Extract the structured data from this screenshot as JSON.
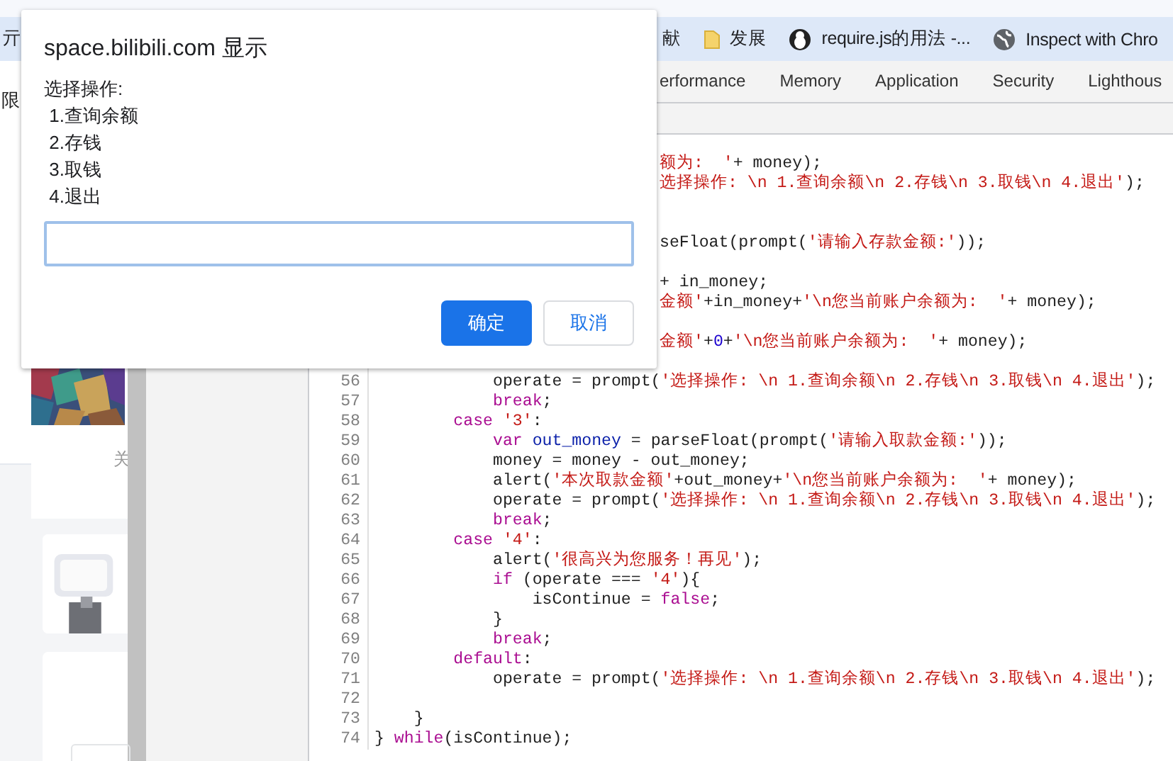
{
  "browser": {
    "bookmarks": [
      {
        "label": "亓",
        "kind": "partial"
      },
      {
        "label": "献",
        "kind": "partial"
      },
      {
        "label": "发展",
        "kind": "folder"
      },
      {
        "label": "require.js的用法 -...",
        "kind": "site"
      },
      {
        "label": "Inspect with Chro",
        "kind": "web"
      }
    ]
  },
  "page": {
    "side_text": "限",
    "card_caption": "关"
  },
  "devtools": {
    "tabs": [
      {
        "label": "erformance",
        "selected": false
      },
      {
        "label": "Memory",
        "selected": false
      },
      {
        "label": "Application",
        "selected": false
      },
      {
        "label": "Security",
        "selected": false
      },
      {
        "label": "Lighthous",
        "selected": false
      }
    ]
  },
  "editor": {
    "lines": [
      {
        "kind": "covered"
      },
      {
        "kind": "covered",
        "tokens": [
          {
            "text": "额为:  '",
            "kind": "string"
          },
          {
            "text": "+ money);",
            "kind": "plain"
          }
        ]
      },
      {
        "kind": "covered",
        "tokens": [
          {
            "text": "选择操作: \\n 1.查询余额\\n 2.存钱\\n 3.取钱\\n 4.退出'",
            "kind": "string"
          },
          {
            "text": ");",
            "kind": "plain"
          }
        ]
      },
      {
        "kind": "covered"
      },
      {
        "kind": "covered"
      },
      {
        "kind": "covered",
        "tokens": [
          {
            "text": "seFloat(prompt(",
            "kind": "plain"
          },
          {
            "text": "'请输入存款金额:'",
            "kind": "string"
          },
          {
            "text": "));",
            "kind": "plain"
          }
        ]
      },
      {
        "kind": "covered"
      },
      {
        "kind": "covered",
        "tokens": [
          {
            "text": "+ in_money;",
            "kind": "plain"
          }
        ]
      },
      {
        "kind": "covered",
        "tokens": [
          {
            "text": "金额'",
            "kind": "string"
          },
          {
            "text": "+in_money+",
            "kind": "plain"
          },
          {
            "text": "'\\n您当前账户余额为:  '",
            "kind": "string"
          },
          {
            "text": "+ money);",
            "kind": "plain"
          }
        ]
      },
      {
        "kind": "covered"
      },
      {
        "kind": "covered",
        "tokens": [
          {
            "text": "金额'",
            "kind": "string"
          },
          {
            "text": "+",
            "kind": "plain"
          },
          {
            "text": "0",
            "kind": "number"
          },
          {
            "text": "+",
            "kind": "plain"
          },
          {
            "text": "'\\n您当前账户余额为:  '",
            "kind": "string"
          },
          {
            "text": "+ money);",
            "kind": "plain"
          }
        ]
      },
      {
        "kind": "covered"
      },
      {
        "kind": "code",
        "number": "56",
        "tokens": [
          {
            "text": "            operate = prompt(",
            "kind": "plain"
          },
          {
            "text": "'选择操作: \\n 1.查询余额\\n 2.存钱\\n 3.取钱\\n 4.退出'",
            "kind": "string"
          },
          {
            "text": ");",
            "kind": "plain"
          }
        ]
      },
      {
        "kind": "code",
        "number": "57",
        "tokens": [
          {
            "text": "            break",
            "kind": "keyword"
          },
          {
            "text": ";",
            "kind": "plain"
          }
        ]
      },
      {
        "kind": "code",
        "number": "58",
        "tokens": [
          {
            "text": "        case",
            "kind": "keyword"
          },
          {
            "text": " '3'",
            "kind": "string"
          },
          {
            "text": ":",
            "kind": "plain"
          }
        ]
      },
      {
        "kind": "code",
        "number": "59",
        "tokens": [
          {
            "text": "            var",
            "kind": "keyword"
          },
          {
            "text": " out_money",
            "kind": "def"
          },
          {
            "text": " = parseFloat(prompt(",
            "kind": "plain"
          },
          {
            "text": "'请输入取款金额:'",
            "kind": "string"
          },
          {
            "text": "));",
            "kind": "plain"
          }
        ]
      },
      {
        "kind": "code",
        "number": "60",
        "tokens": [
          {
            "text": "            money = money - out_money;",
            "kind": "plain"
          }
        ]
      },
      {
        "kind": "code",
        "number": "61",
        "tokens": [
          {
            "text": "            alert(",
            "kind": "plain"
          },
          {
            "text": "'本次取款金额'",
            "kind": "string"
          },
          {
            "text": "+out_money+",
            "kind": "plain"
          },
          {
            "text": "'\\n您当前账户余额为:  '",
            "kind": "string"
          },
          {
            "text": "+ money);",
            "kind": "plain"
          }
        ]
      },
      {
        "kind": "code",
        "number": "62",
        "tokens": [
          {
            "text": "            operate = prompt(",
            "kind": "plain"
          },
          {
            "text": "'选择操作: \\n 1.查询余额\\n 2.存钱\\n 3.取钱\\n 4.退出'",
            "kind": "string"
          },
          {
            "text": ");",
            "kind": "plain"
          }
        ]
      },
      {
        "kind": "code",
        "number": "63",
        "tokens": [
          {
            "text": "            break",
            "kind": "keyword"
          },
          {
            "text": ";",
            "kind": "plain"
          }
        ]
      },
      {
        "kind": "code",
        "number": "64",
        "tokens": [
          {
            "text": "        case",
            "kind": "keyword"
          },
          {
            "text": " '4'",
            "kind": "string"
          },
          {
            "text": ":",
            "kind": "plain"
          }
        ]
      },
      {
        "kind": "code",
        "number": "65",
        "tokens": [
          {
            "text": "            alert(",
            "kind": "plain"
          },
          {
            "text": "'很高兴为您服务！再见'",
            "kind": "string"
          },
          {
            "text": ");",
            "kind": "plain"
          }
        ]
      },
      {
        "kind": "code",
        "number": "66",
        "tokens": [
          {
            "text": "            if",
            "kind": "keyword"
          },
          {
            "text": " (operate === ",
            "kind": "plain"
          },
          {
            "text": "'4'",
            "kind": "string"
          },
          {
            "text": "){",
            "kind": "plain"
          }
        ]
      },
      {
        "kind": "code",
        "number": "67",
        "tokens": [
          {
            "text": "                isContinue = ",
            "kind": "plain"
          },
          {
            "text": "false",
            "kind": "keyword"
          },
          {
            "text": ";",
            "kind": "plain"
          }
        ]
      },
      {
        "kind": "code",
        "number": "68",
        "tokens": [
          {
            "text": "            }",
            "kind": "plain"
          }
        ]
      },
      {
        "kind": "code",
        "number": "69",
        "tokens": [
          {
            "text": "            break",
            "kind": "keyword"
          },
          {
            "text": ";",
            "kind": "plain"
          }
        ]
      },
      {
        "kind": "code",
        "number": "70",
        "tokens": [
          {
            "text": "        default",
            "kind": "keyword"
          },
          {
            "text": ":",
            "kind": "plain"
          }
        ]
      },
      {
        "kind": "code",
        "number": "71",
        "tokens": [
          {
            "text": "            operate = prompt(",
            "kind": "plain"
          },
          {
            "text": "'选择操作: \\n 1.查询余额\\n 2.存钱\\n 3.取钱\\n 4.退出'",
            "kind": "string"
          },
          {
            "text": ");",
            "kind": "plain"
          }
        ]
      },
      {
        "kind": "code",
        "number": "72"
      },
      {
        "kind": "code",
        "number": "73",
        "tokens": [
          {
            "text": "    }",
            "kind": "plain"
          }
        ]
      },
      {
        "kind": "code",
        "number": "74",
        "tokens": [
          {
            "text": "} ",
            "kind": "plain"
          },
          {
            "text": "while",
            "kind": "keyword"
          },
          {
            "text": "(isContinue);",
            "kind": "plain"
          }
        ]
      }
    ]
  },
  "dialog": {
    "title": "space.bilibili.com 显示",
    "message": "选择操作: \n 1.查询余额\n 2.存钱\n 3.取钱\n 4.退出",
    "input": {
      "focused": true
    },
    "buttons": [
      {
        "label": "确定",
        "kind": "primary"
      },
      {
        "label": "取消",
        "kind": "secondary"
      }
    ]
  }
}
